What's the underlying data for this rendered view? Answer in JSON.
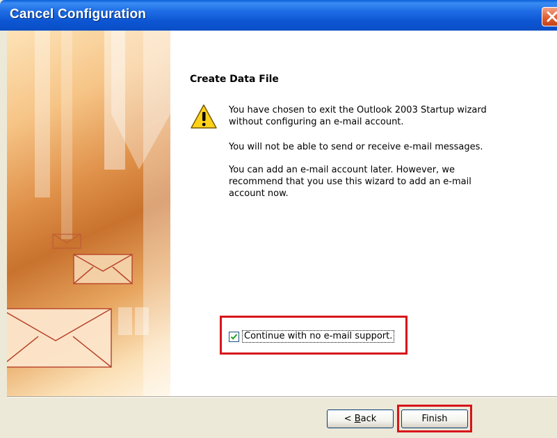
{
  "window": {
    "title": "Cancel Configuration",
    "close_icon": "close-icon"
  },
  "content": {
    "heading": "Create Data File",
    "warning_icon": "warning-icon",
    "message_1": "You have chosen to exit the Outlook 2003 Startup wizard without configuring an e-mail account.",
    "message_2": "You will not be able to send or receive e-mail messages.",
    "message_3": "You can add an e-mail account later. However, we recommend that you use this wizard to add an e-mail account now."
  },
  "checkbox": {
    "label": "Continue with no e-mail support.",
    "checked": true
  },
  "buttons": {
    "back_prefix": "< ",
    "back_mnemonic": "B",
    "back_rest": "ack",
    "finish": "Finish"
  },
  "colors": {
    "highlight": "#d7141a",
    "titlebar": "#0c55d2"
  }
}
